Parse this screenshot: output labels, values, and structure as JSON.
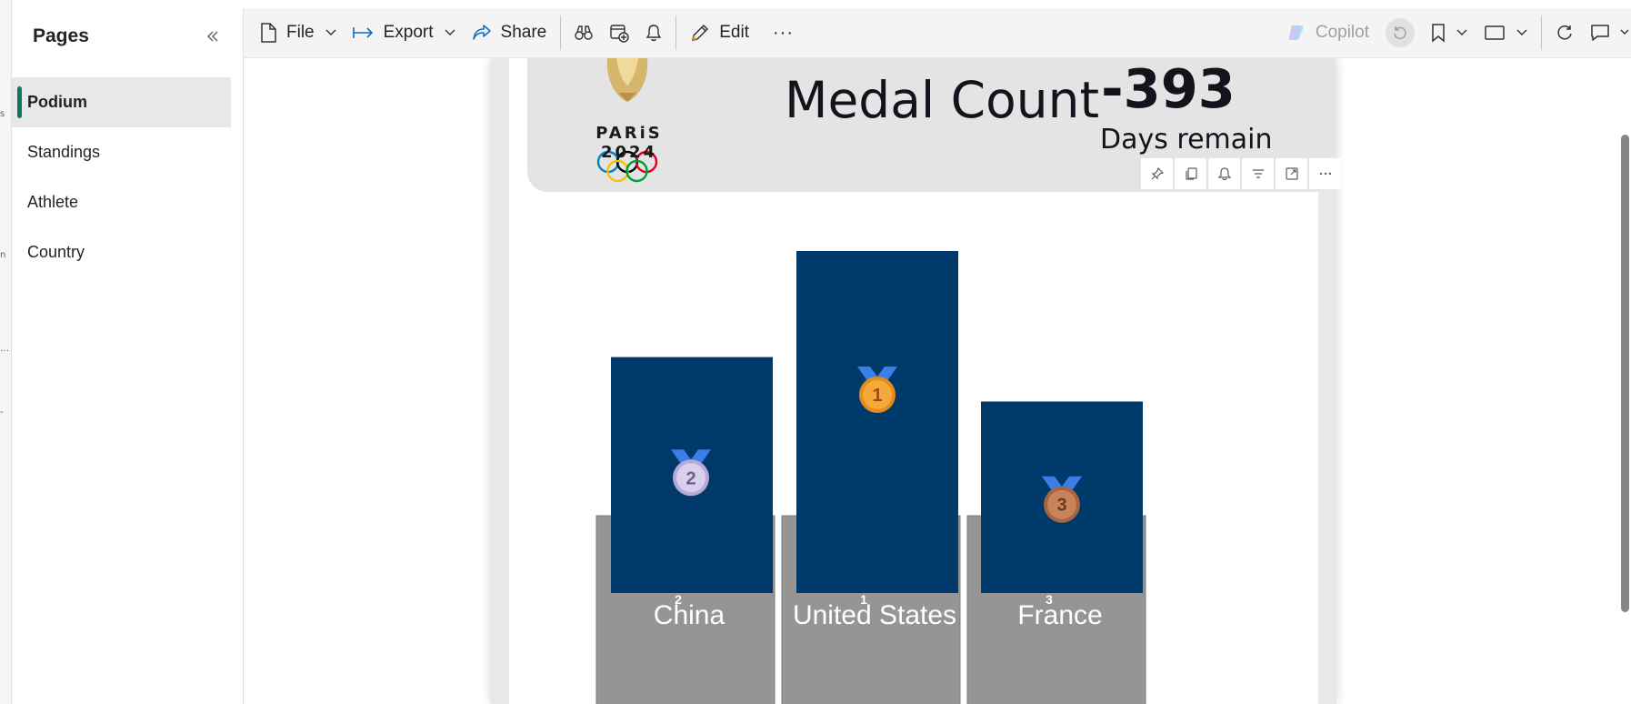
{
  "pages_pane": {
    "title": "Pages",
    "items": [
      {
        "label": "Podium",
        "active": true
      },
      {
        "label": "Standings",
        "active": false
      },
      {
        "label": "Athlete",
        "active": false
      },
      {
        "label": "Country",
        "active": false
      }
    ]
  },
  "toolbar": {
    "file_label": "File",
    "export_label": "Export",
    "share_label": "Share",
    "edit_label": "Edit",
    "more_label": "···",
    "copilot_label": "Copilot"
  },
  "header_card": {
    "logo_text": "PARiS 2024",
    "title": "Medal Count",
    "days_value": "-393",
    "days_label": "Days remain"
  },
  "colors": {
    "bar": "#003a6b",
    "podium_base": "#959595",
    "accent": "#117865",
    "logo_gold": "#d6b56c"
  },
  "chart_data": {
    "type": "bar",
    "categories": [
      "China",
      "United States",
      "France"
    ],
    "ranks": [
      "2",
      "1",
      "3"
    ],
    "series": [
      {
        "values": [
          0.69,
          1.0,
          0.56
        ]
      }
    ],
    "medal_icons": [
      "silver-medal-2",
      "gold-medal-1",
      "bronze-medal-3"
    ],
    "title": "",
    "xlabel": "",
    "ylabel": ""
  }
}
